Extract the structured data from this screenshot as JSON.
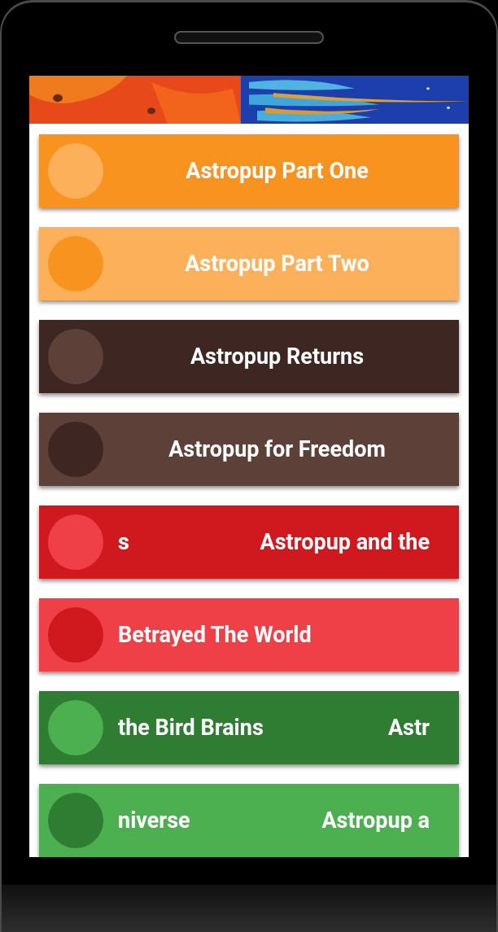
{
  "episodes": [
    {
      "kind": "centered",
      "texts": [
        "Astropup Part One"
      ],
      "color": "#f7931e",
      "avatar": {
        "color": "#fdb05a"
      }
    },
    {
      "kind": "centered",
      "texts": [
        "Astropup Part Two"
      ],
      "color": "#fdb05a",
      "avatar": {
        "color": "#f7931e"
      }
    },
    {
      "kind": "centered",
      "texts": [
        "Astropup Returns"
      ],
      "color": "#3e2723",
      "avatar": {
        "color": "#5d4037"
      }
    },
    {
      "kind": "centered",
      "texts": [
        "Astropup for Freedom"
      ],
      "color": "#5d4037",
      "avatar": {
        "color": "#3e2723"
      }
    },
    {
      "kind": "marquee",
      "texts": [
        "s",
        "Astropup and the"
      ],
      "color": "#d0191f",
      "avatar": {
        "color": "#ef4047"
      }
    },
    {
      "kind": "marquee",
      "texts": [
        "Betrayed The World"
      ],
      "color": "#ef4047",
      "avatar": {
        "color": "#d0191f"
      }
    },
    {
      "kind": "marquee",
      "texts": [
        "the Bird Brains",
        "Astr"
      ],
      "color": "#2e7d32",
      "avatar": {
        "color": "#4caf50"
      }
    },
    {
      "kind": "marquee",
      "texts": [
        "niverse",
        "Astropup a"
      ],
      "color": "#4caf50",
      "avatar": {
        "color": "#2e7d32"
      }
    }
  ]
}
